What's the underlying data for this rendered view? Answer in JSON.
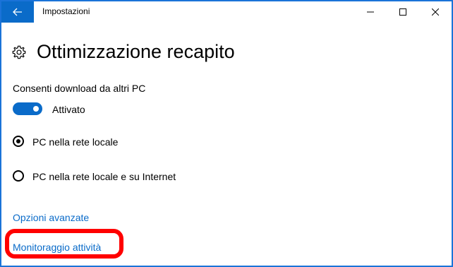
{
  "window": {
    "title": "Impostazioni"
  },
  "header": {
    "title": "Ottimizzazione recapito"
  },
  "settings": {
    "allow_label": "Consenti download da altri PC",
    "toggle_label": "Attivato",
    "toggle_on": true,
    "radio_options": [
      {
        "label": "PC nella rete locale",
        "selected": true
      },
      {
        "label": "PC nella rete locale e su Internet",
        "selected": false
      }
    ]
  },
  "links": {
    "advanced": "Opzioni avanzate",
    "activity": "Monitoraggio attività"
  },
  "colors": {
    "accent": "#0a6bc9",
    "annotation": "#ff0000"
  },
  "icons": {
    "back": "arrow-left-icon",
    "minimize": "minimize-icon",
    "maximize": "maximize-icon",
    "close": "close-icon",
    "header": "gear-icon"
  }
}
